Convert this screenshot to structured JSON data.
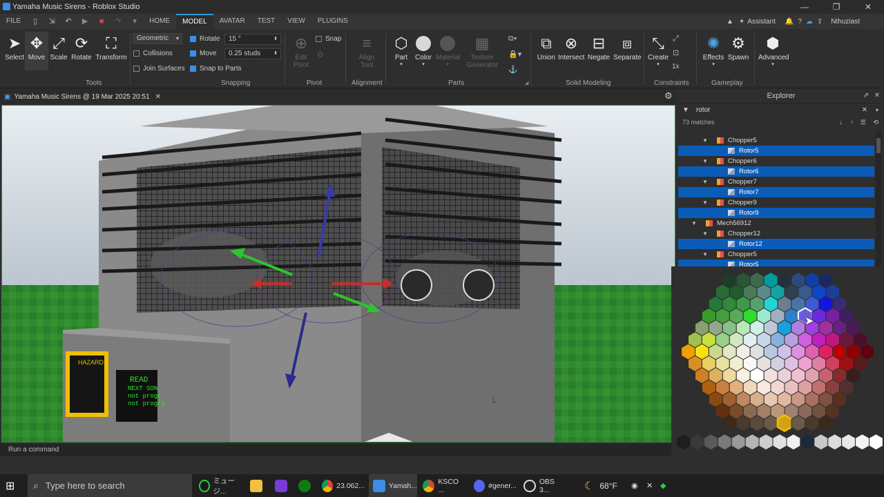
{
  "window": {
    "title": "Yamaha Music Sirens - Roblox Studio",
    "minimize": "—",
    "maximize": "❐",
    "close": "✕"
  },
  "menu": {
    "file": "FILE",
    "tabs": [
      "HOME",
      "MODEL",
      "AVATAR",
      "TEST",
      "VIEW",
      "PLUGINS"
    ],
    "active_tab": "MODEL",
    "assistant": "Assistant",
    "user": "Nthuziast"
  },
  "ribbon": {
    "tools": {
      "select": "Select",
      "move": "Move",
      "scale": "Scale",
      "rotate": "Rotate",
      "transform": "Transform",
      "group": "Tools"
    },
    "snapping": {
      "mode": "Geometric",
      "collisions": "Collisions",
      "join_surfaces": "Join Surfaces",
      "rotate_label": "Rotate",
      "rotate_value": "15 °",
      "move_label": "Move",
      "move_value": "0.25 studs",
      "snap_to_parts": "Snap to Parts",
      "group": "Snapping"
    },
    "pivot": {
      "edit_pivot_1": "Edit",
      "edit_pivot_2": "Pivot",
      "snap": "Snap",
      "group": "Pivot"
    },
    "alignment": {
      "align_1": "Align",
      "align_2": "Tool",
      "group": "Alignment"
    },
    "parts": {
      "part": "Part",
      "color": "Color",
      "material": "Material",
      "texture_1": "Texture",
      "texture_2": "Generator",
      "group": "Parts"
    },
    "solid": {
      "union": "Union",
      "intersect": "Intersect",
      "negate": "Negate",
      "separate": "Separate",
      "group": "Solid Modeling"
    },
    "constraints": {
      "create": "Create",
      "scale": "1x",
      "group": "Constraints"
    },
    "gameplay": {
      "effects": "Effects",
      "spawn": "Spawn",
      "group": "Gameplay"
    },
    "advanced": "Advanced"
  },
  "doc_tab": {
    "label": "Yamaha Music Sirens @ 19 Mar 2025 20:51",
    "close": "✕"
  },
  "viewport": {
    "panel_text": [
      "HAZARD",
      "READ",
      "NEXT SON",
      "not progr",
      "not progra"
    ]
  },
  "command_bar": {
    "placeholder": "Run a command"
  },
  "explorer": {
    "title": "Explorer",
    "filter": "rotor",
    "matches": "73 matches",
    "rows": [
      {
        "label": "Chopper5",
        "kind": "model",
        "indent": 1,
        "selected": false
      },
      {
        "label": "Rotor5",
        "kind": "part",
        "indent": 2,
        "selected": true
      },
      {
        "label": "Chopper6",
        "kind": "model",
        "indent": 1,
        "selected": false
      },
      {
        "label": "Rotor6",
        "kind": "part",
        "indent": 2,
        "selected": true
      },
      {
        "label": "Chopper7",
        "kind": "model",
        "indent": 1,
        "selected": false
      },
      {
        "label": "Rotor7",
        "kind": "part",
        "indent": 2,
        "selected": true
      },
      {
        "label": "Chopper9",
        "kind": "model",
        "indent": 1,
        "selected": false
      },
      {
        "label": "Rotor9",
        "kind": "part",
        "indent": 2,
        "selected": true
      },
      {
        "label": "Mech56912",
        "kind": "model",
        "indent": 0,
        "selected": false
      },
      {
        "label": "Chopper12",
        "kind": "model",
        "indent": 1,
        "selected": false
      },
      {
        "label": "Rotor12",
        "kind": "part",
        "indent": 2,
        "selected": true
      },
      {
        "label": "Chopper5",
        "kind": "model",
        "indent": 1,
        "selected": false
      },
      {
        "label": "Rotor5",
        "kind": "part",
        "indent": 2,
        "selected": true
      }
    ]
  },
  "color_picker": {
    "more_colors": "More Colors",
    "rows": [
      [
        "#1f3c2a",
        "#2b5737",
        "#3d6b4e",
        "#009c9c",
        "#20313c",
        "#2a4b7a",
        "#0f3ea8",
        "#19285e"
      ],
      [
        "#2a6a36",
        "#1e5c2c",
        "#4a7a5a",
        "#5a8a8a",
        "#12a3a3",
        "#304050",
        "#3a5a8a",
        "#0d47c8",
        "#1d3d9a"
      ],
      [
        "#23783a",
        "#2f8a3c",
        "#3a9b4a",
        "#5aa06a",
        "#22d4d4",
        "#6c7f90",
        "#4a74a8",
        "#3c5cd6",
        "#1414e0",
        "#3a2a7a"
      ],
      [
        "#3a9b2a",
        "#41a03e",
        "#5aa85a",
        "#2edc2e",
        "#9fe8d0",
        "#a0b0c0",
        "#2e7ec8",
        "#6a5cd8",
        "#6a2be0",
        "#7b1fa2",
        "#3c2060"
      ],
      [
        "#8aa070",
        "#90a88a",
        "#88c088",
        "#b8e8b8",
        "#d0f0e8",
        "#c0c8d8",
        "#18a0d8",
        "#b080e0",
        "#a040e0",
        "#a030a0",
        "#6a2080",
        "#4a1a5a"
      ],
      [
        "#a0c050",
        "#c8e040",
        "#98d088",
        "#d0e8c0",
        "#e0f0f0",
        "#c8d8e8",
        "#88b0d8",
        "#b8a0e0",
        "#d060e0",
        "#c020c0",
        "#c01880",
        "#6a1840",
        "#4a102a"
      ],
      [
        "#f0a000",
        "#f8e010",
        "#c8d890",
        "#e0e8c8",
        "#f0f0e8",
        "#e0e0e0",
        "#b8c8e0",
        "#d0c0e8",
        "#e090e0",
        "#e060b0",
        "#e02060",
        "#c00000",
        "#900000",
        "#600010"
      ],
      [
        "#d89020",
        "#e8d060",
        "#e8e0a0",
        "#f0f0d0",
        "#f8f8f8",
        "#e8e0e0",
        "#d0d0e0",
        "#e0c0e0",
        "#f0a0d0",
        "#e080a0",
        "#d04060",
        "#a01010",
        "#5a1a1a"
      ],
      [
        "#d08020",
        "#e0b060",
        "#f0d8a0",
        "#f8f0e0",
        "#ffffff",
        "#f0e0e0",
        "#e8d0d8",
        "#f0c0d0",
        "#e0a0b0",
        "#c86070",
        "#8a2a2a",
        "#3a1c1c"
      ],
      [
        "#b06010",
        "#c88040",
        "#e0b080",
        "#f0d8c0",
        "#f8e8e0",
        "#f0d8d0",
        "#e8c0c0",
        "#e0a0a0",
        "#c07070",
        "#8a4040",
        "#503030"
      ],
      [
        "#8a4a10",
        "#a06030",
        "#c08860",
        "#d8b090",
        "#e8c8b0",
        "#e0b8a0",
        "#c89888",
        "#a87060",
        "#805040",
        "#5a3020"
      ],
      [
        "#603010",
        "#7a4a2a",
        "#8a6a50",
        "#a08068",
        "#b89878",
        "#a08070",
        "#8a6a5a",
        "#705040",
        "#553322"
      ],
      [
        "#3a2a1a",
        "#4a3a2a",
        "#5a4a3a",
        "#6a5a4a",
        "#d4a017",
        "#6a5a4a",
        "#4a3a2a",
        "#3a2a1a"
      ]
    ],
    "grays": [
      "#1e1e1e",
      "#3a3a3a",
      "#5a5a5a",
      "#7a7a7a",
      "#9a9a9a",
      "#b4b4b4",
      "#cdcdcd",
      "#e0e0e0",
      "#f0f0f0",
      "#1a2a3a",
      "#c8c8c8",
      "#dcdcdc",
      "#e8e8e8",
      "#f4f4f4",
      "#ffffff"
    ]
  },
  "taskbar": {
    "search_placeholder": "Type here to search",
    "items": [
      "ミュージ...",
      "",
      "",
      "",
      "23.062...",
      "Yamah...",
      "KSCO ...",
      "#gener...",
      "OBS 3..."
    ],
    "weather": "68°F"
  }
}
